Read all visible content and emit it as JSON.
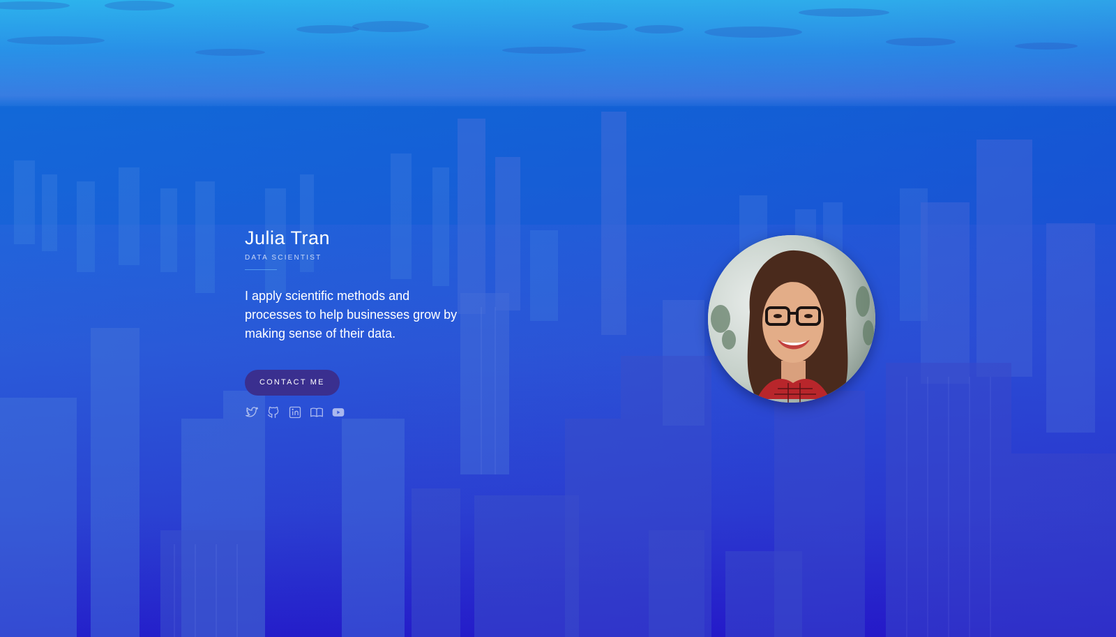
{
  "profile": {
    "name": "Julia Tran",
    "role": "DATA SCIENTIST",
    "description": "I apply scientific methods and processes to help businesses grow by making sense of their data.",
    "cta_label": "CONTACT ME"
  },
  "social": [
    {
      "icon": "twitter-icon"
    },
    {
      "icon": "github-icon"
    },
    {
      "icon": "linkedin-icon"
    },
    {
      "icon": "blog-icon"
    },
    {
      "icon": "youtube-icon"
    }
  ],
  "colors": {
    "accent": "#3a2f8f",
    "text": "#ffffff",
    "background_top": "#2fb6ec",
    "background_bottom": "#2418c8"
  }
}
